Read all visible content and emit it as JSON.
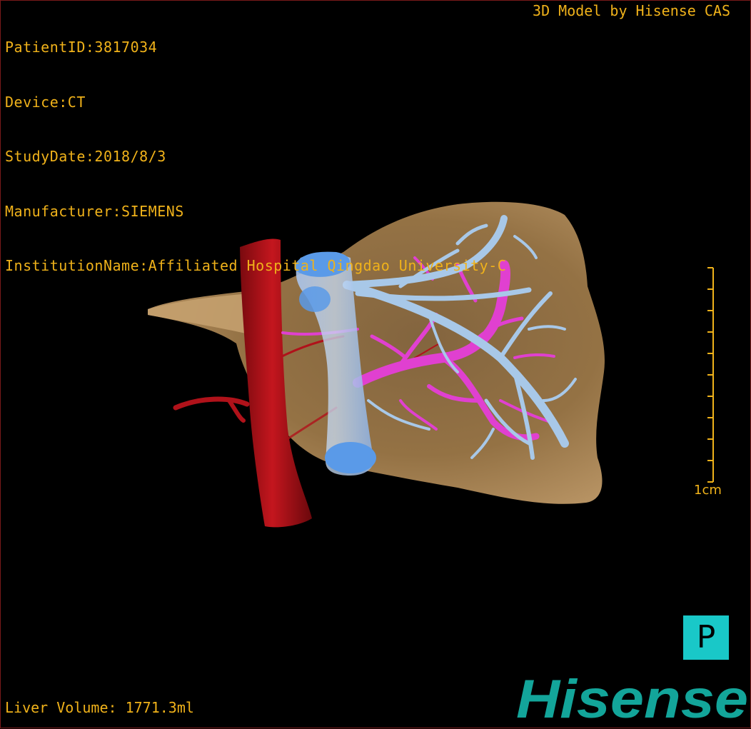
{
  "header": {
    "patient_id": "PatientID:3817034",
    "device": "Device:CT",
    "study_date": "StudyDate:2018/8/3",
    "manufacturer": "Manufacturer:SIEMENS",
    "institution": "InstitutionName:Affiliated Hospital Qingdao University-C"
  },
  "credit": "3D Model by Hisense CAS",
  "scale_bar": {
    "label": "1cm"
  },
  "orientation": {
    "label": "P"
  },
  "footer": {
    "liver_volume": "Liver Volume: 1771.3ml"
  },
  "logo": {
    "text": "Hisense"
  },
  "colors": {
    "overlay_text": "#f0b21a",
    "liver": "#a07845",
    "aorta": "#b0121a",
    "portal_vein": "#e040d0",
    "hepatic_vein": "#a8c8e8",
    "ivc": "#5a9ae8",
    "orientation_badge": "#19c8c8",
    "logo": "#13a59a"
  },
  "structures": [
    "liver",
    "aorta",
    "hepatic-artery",
    "portal-vein",
    "hepatic-veins",
    "inferior-vena-cava"
  ]
}
